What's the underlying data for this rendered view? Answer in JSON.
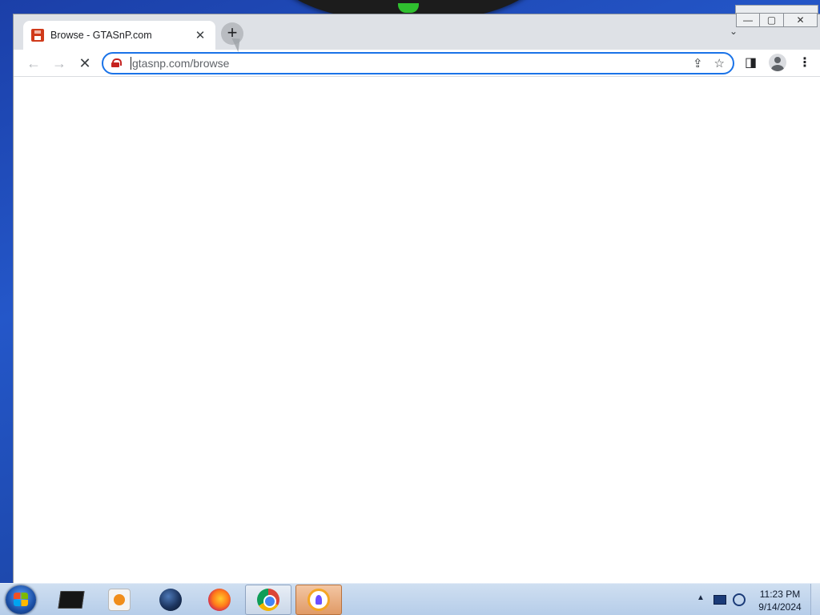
{
  "browser": {
    "tab": {
      "title": "Browse - GTASnP.com",
      "close_glyph": "✕"
    },
    "new_tab_glyph": "+",
    "tab_search_glyph": "⌄",
    "window_controls": {
      "minimize": "—",
      "maximize": "▢",
      "close": "✕"
    },
    "toolbar": {
      "back_glyph": "←",
      "forward_glyph": "→",
      "stop_glyph": "✕",
      "url": "gtasnp.com/browse",
      "share_glyph": "⇪",
      "bookmark_glyph": "☆",
      "side_panel_glyph": "◨",
      "menu_glyph": "⋮"
    }
  },
  "taskbar": {
    "apps": [
      {
        "name": "terminal-app",
        "icon": "terminal-icon"
      },
      {
        "name": "media-player-app",
        "icon": "media-player-icon"
      },
      {
        "name": "globe-app",
        "icon": "globe-icon"
      },
      {
        "name": "firefox-app",
        "icon": "firefox-icon"
      },
      {
        "name": "chrome-app",
        "icon": "chrome-icon"
      },
      {
        "name": "vpn-app",
        "icon": "vpn-icon"
      }
    ],
    "tray_arrow": "▲",
    "clock": {
      "time": "11:23 PM",
      "date": "9/14/2024"
    }
  }
}
